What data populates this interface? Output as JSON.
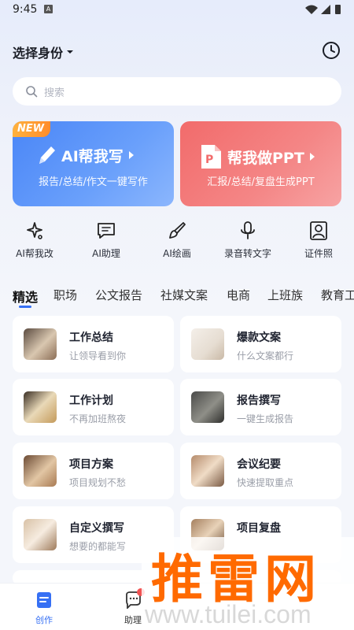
{
  "status_bar": {
    "time": "9:45",
    "notif_letter": "A"
  },
  "header": {
    "identity_label": "选择身份"
  },
  "search": {
    "placeholder": "搜索"
  },
  "promo": {
    "left": {
      "badge": "NEW",
      "title": "AI帮我写",
      "subtitle": "报告/总结/作文一键写作"
    },
    "right": {
      "title": "帮我做PPT",
      "subtitle": "汇报/总结/复盘生成PPT",
      "icon_letter": "P"
    }
  },
  "tools": [
    {
      "label": "AI帮我改",
      "icon": "sparkle-icon"
    },
    {
      "label": "AI助理",
      "icon": "chat-icon"
    },
    {
      "label": "AI绘画",
      "icon": "brush-icon"
    },
    {
      "label": "录音转文字",
      "icon": "microphone-icon"
    },
    {
      "label": "证件照",
      "icon": "id-photo-icon"
    }
  ],
  "tabs": [
    "精选",
    "职场",
    "公文报告",
    "社媒文案",
    "电商",
    "上班族",
    "教育工"
  ],
  "cards": [
    {
      "title": "工作总结",
      "subtitle": "让领导看到你"
    },
    {
      "title": "爆款文案",
      "subtitle": "什么文案都行"
    },
    {
      "title": "工作计划",
      "subtitle": "不再加班熬夜"
    },
    {
      "title": "报告撰写",
      "subtitle": "一键生成报告"
    },
    {
      "title": "项目方案",
      "subtitle": "项目规划不愁"
    },
    {
      "title": "会议纪要",
      "subtitle": "快速提取重点"
    },
    {
      "title": "自定义撰写",
      "subtitle": "想要的都能写"
    },
    {
      "title": "项目复盘",
      "subtitle": ""
    }
  ],
  "bottom_nav": [
    {
      "label": "创作",
      "icon": "create-icon",
      "active": true
    },
    {
      "label": "助理",
      "icon": "assistant-icon",
      "active": false
    }
  ],
  "watermark": {
    "big": "推雷网",
    "small": "www.tuilei.com"
  },
  "colors": {
    "accent": "#3670f4",
    "promo_blue": "#4a86f7",
    "promo_red": "#f26b6b",
    "badge_orange": "#ff8c2a"
  }
}
